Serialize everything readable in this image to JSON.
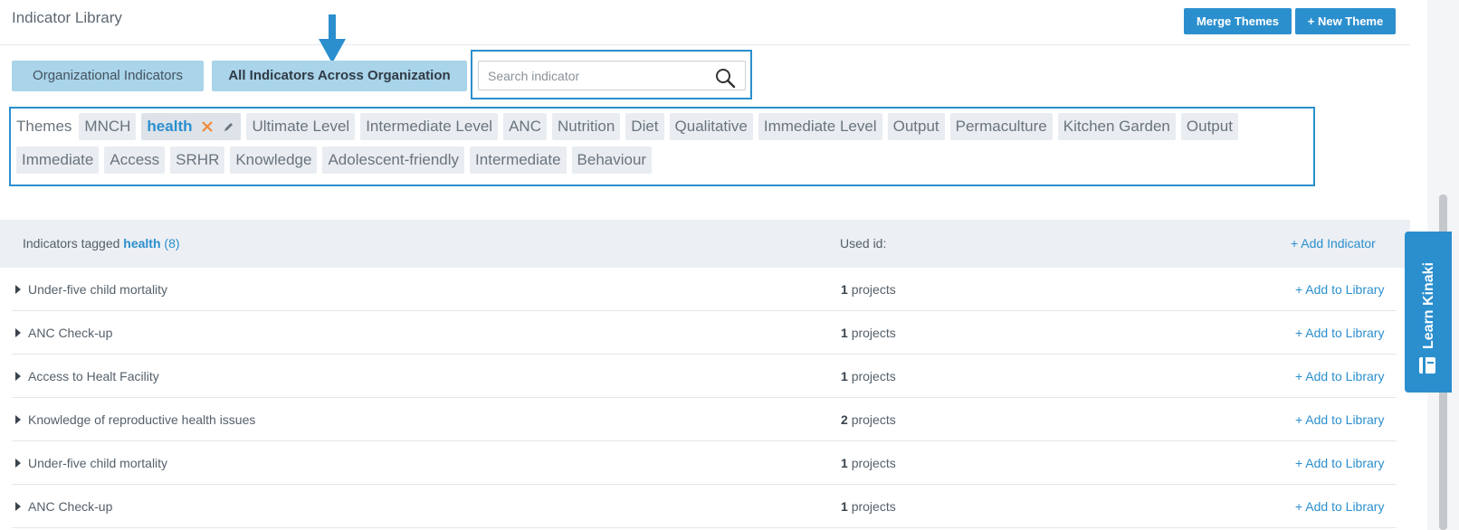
{
  "header": {
    "title": "Indicator Library",
    "merge_label": "Merge Themes",
    "new_theme_label": "+ New Theme"
  },
  "filters": {
    "org_label": "Organizational Indicators",
    "all_label": "All Indicators Across Organization"
  },
  "search": {
    "placeholder": "Search indicator",
    "value": ""
  },
  "themes": {
    "label": "Themes",
    "row1": [
      "MNCH",
      "health",
      "Ultimate Level",
      "Intermediate Level",
      "ANC",
      "Nutrition",
      "Diet",
      "Qualitative",
      "Immediate Level",
      "Output",
      "Permaculture",
      "Kitchen Garden",
      "Output"
    ],
    "row2": [
      "Immediate",
      "Access",
      "SRHR",
      "Knowledge",
      "Adolescent-friendly",
      "Intermediate",
      "Behaviour"
    ],
    "active": "health"
  },
  "table": {
    "prefix": "Indicators tagged ",
    "tag": "health",
    "count": "(8)",
    "used_label": "Used id:",
    "add_indicator": "+ Add Indicator",
    "rows": [
      {
        "name": "Under-five child mortality",
        "count": "1",
        "unit": "projects",
        "action": "+ Add to Library"
      },
      {
        "name": "ANC Check-up",
        "count": "1",
        "unit": "projects",
        "action": "+ Add to Library"
      },
      {
        "name": "Access to Healt Facility",
        "count": "1",
        "unit": "projects",
        "action": "+ Add to Library"
      },
      {
        "name": "Knowledge of reproductive health issues",
        "count": "2",
        "unit": "projects",
        "action": "+ Add to Library"
      },
      {
        "name": "Under-five child mortality",
        "count": "1",
        "unit": "projects",
        "action": "+ Add to Library"
      },
      {
        "name": "ANC Check-up",
        "count": "1",
        "unit": "projects",
        "action": "+ Add to Library"
      }
    ]
  },
  "learn_tab": {
    "label": "Learn Kinaki"
  },
  "colors": {
    "accent": "#2b8fce",
    "close": "#f0883a",
    "filter_bg": "#a9d4ea",
    "tag_bg": "#e9edf1"
  },
  "icons": {
    "search": "search-icon",
    "remove_tag": "close-icon",
    "edit_tag": "pencil-icon",
    "expand": "caret-right-icon",
    "arrow": "arrow-down-icon",
    "book": "book-icon"
  }
}
